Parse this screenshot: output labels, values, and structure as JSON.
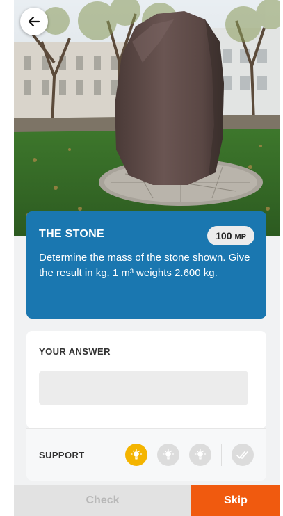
{
  "icons": {
    "back": "arrow-left-icon",
    "hint1": "lightbulb-icon",
    "hint2": "lightbulb-icon",
    "hint3": "lightbulb-icon",
    "solution": "double-check-icon"
  },
  "colors": {
    "task_card": "#1a77b0",
    "hint_active": "#f4b400",
    "skip_button": "#f05a0f",
    "check_button": "#e2e2e2"
  },
  "task": {
    "title": "THE STONE",
    "points_value": "100",
    "points_unit": "MP",
    "description": "Determine the mass of the stone shown. Give the result in kg. 1 m³ weights 2.600 kg."
  },
  "answer": {
    "label": "YOUR ANSWER",
    "value": ""
  },
  "support": {
    "label": "SUPPORT"
  },
  "actions": {
    "check_label": "Check",
    "skip_label": "Skip"
  }
}
